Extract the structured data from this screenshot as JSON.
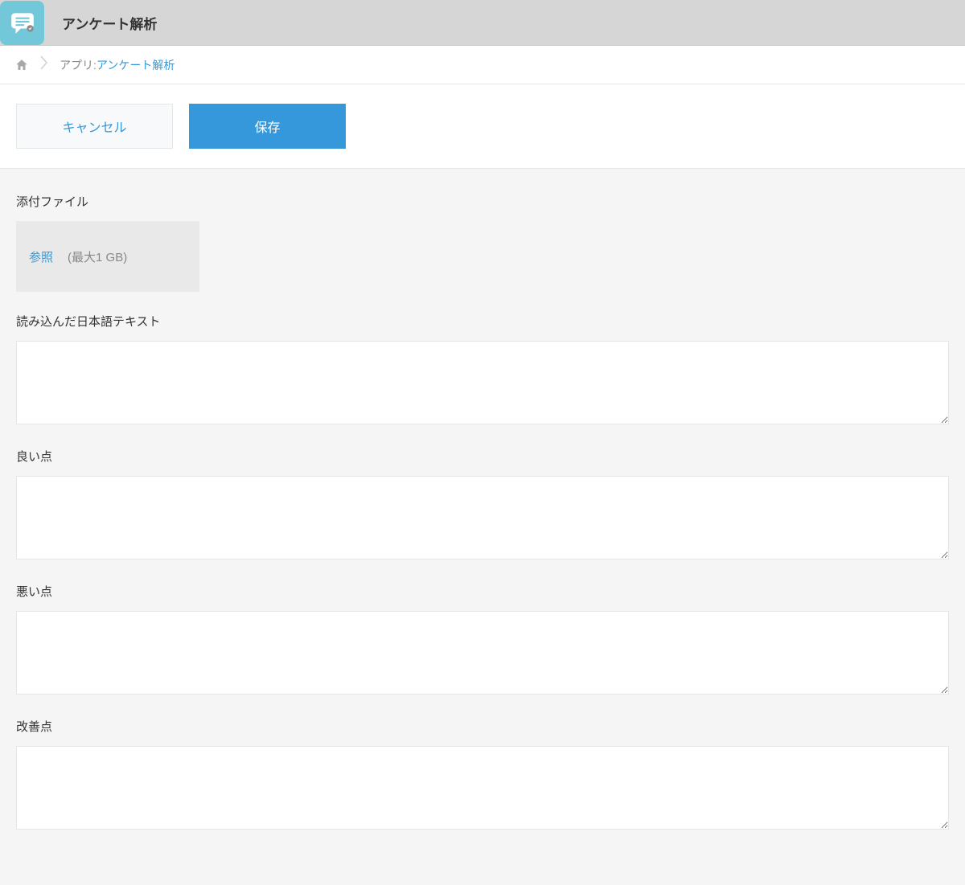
{
  "header": {
    "title": "アンケート解析",
    "icon_name": "speech-bubble-icon"
  },
  "breadcrumb": {
    "app_label": "アプリ: ",
    "app_link_text": "アンケート解析"
  },
  "actions": {
    "cancel_label": "キャンセル",
    "save_label": "保存"
  },
  "fields": {
    "attachment": {
      "label": "添付ファイル",
      "browse_label": "参照",
      "hint": "(最大1 GB)"
    },
    "loaded_text": {
      "label": "読み込んだ日本語テキスト",
      "value": ""
    },
    "good_points": {
      "label": "良い点",
      "value": ""
    },
    "bad_points": {
      "label": "悪い点",
      "value": ""
    },
    "improvements": {
      "label": "改善点",
      "value": ""
    }
  }
}
